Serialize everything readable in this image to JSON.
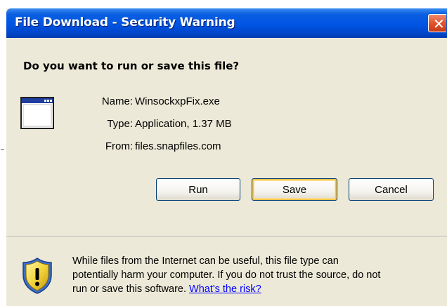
{
  "window": {
    "title": "File Download - Security Warning",
    "close_glyph": "✕"
  },
  "dialog": {
    "heading": "Do you want to run or save this file?",
    "file_icon": "application-window-icon",
    "file_info": [
      {
        "label": "Name:",
        "value": "WinsockxpFix.exe"
      },
      {
        "label": "Type:",
        "value": "Application, 1.37 MB"
      },
      {
        "label": "From:",
        "value": "files.snapfiles.com"
      }
    ],
    "buttons": {
      "run": "Run",
      "save": "Save",
      "cancel": "Cancel"
    },
    "warning": {
      "icon": "shield-warning-icon",
      "line1": "While files from the Internet can be useful, this file type can",
      "line2": "potentially harm your computer. If you do not trust the source, do not",
      "line3_prefix": "run or save this software. ",
      "risk_link": "What's the risk?"
    }
  },
  "colors": {
    "titlebar": "#0054e3",
    "dialog_bg": "#ece9d8",
    "close_button": "#e0502a",
    "link": "#0000ff",
    "focus_ring": "#f7c44a"
  }
}
